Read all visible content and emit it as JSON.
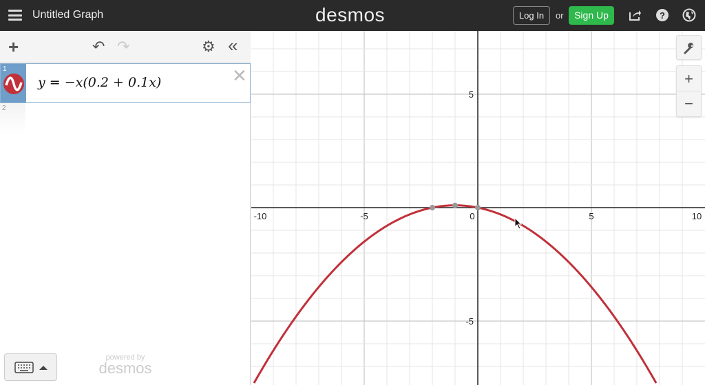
{
  "topbar": {
    "title": "Untitled Graph",
    "logo": "desmos",
    "login": "Log In",
    "or": "or",
    "signup": "Sign Up",
    "icons": [
      "menu-icon",
      "share-icon",
      "help-icon",
      "globe-icon"
    ]
  },
  "toolbar": {
    "add": "+",
    "undo": "↶",
    "redo": "↷",
    "settings": "⚙",
    "collapse": "«"
  },
  "expressions": [
    {
      "index": "1",
      "latex": "y = −x(0.2 + 0.1x)",
      "color": "#c0313a"
    },
    {
      "index": "2"
    }
  ],
  "footer": {
    "powered": "powered by",
    "brand": "desmos"
  },
  "graph": {
    "xmin": -10,
    "xmax": 10,
    "ymin": -7.8,
    "ymax": 7.8,
    "x_ticks": [
      "-10",
      "-5",
      "0",
      "5",
      "10"
    ],
    "y_ticks": [
      "5",
      "-5"
    ],
    "curve": {
      "a": -0.1,
      "b": -0.2,
      "c": 0,
      "color": "#c0313a"
    },
    "points": [
      [
        -2,
        0
      ],
      [
        -1,
        0.1
      ],
      [
        0,
        0
      ]
    ],
    "zoom_in": "+",
    "zoom_out": "−"
  }
}
